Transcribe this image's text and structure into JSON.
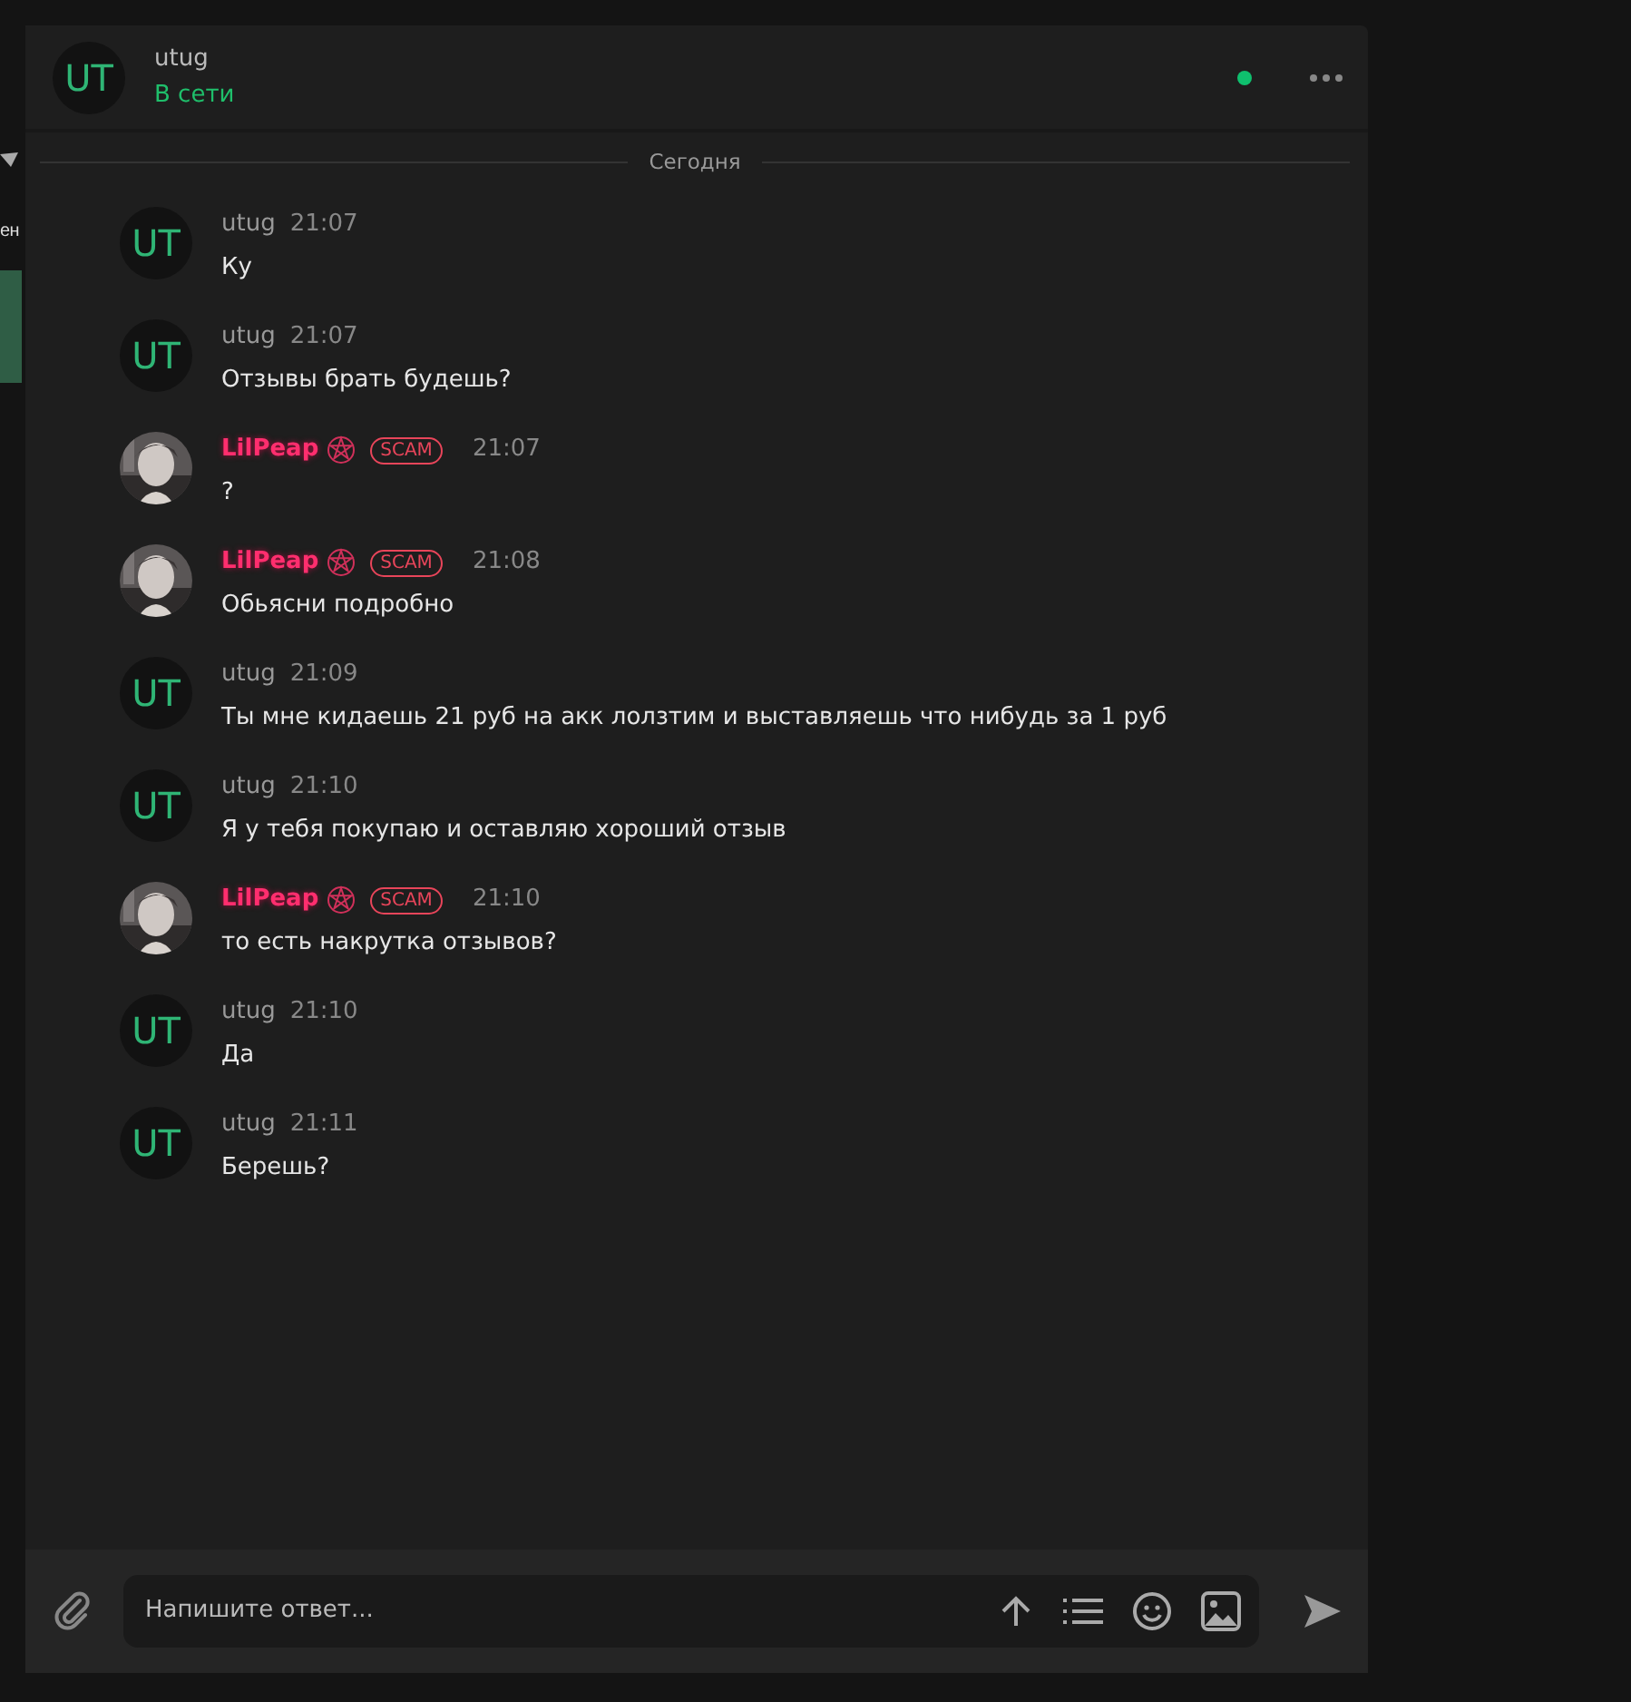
{
  "sidebar": {
    "text_fragment": "ен"
  },
  "chat_header": {
    "avatar_initials": "UT",
    "name": "utug",
    "status": "В сети",
    "online": true
  },
  "date_divider": "Сегодня",
  "messages": [
    {
      "author": "utug",
      "kind": "user",
      "avatar_initials": "UT",
      "time": "21:07",
      "text": "Ку"
    },
    {
      "author": "utug",
      "kind": "user",
      "avatar_initials": "UT",
      "time": "21:07",
      "text": "Отзывы брать будешь?"
    },
    {
      "author": "LilPeap",
      "kind": "scam",
      "badge": "SCAM",
      "time": "21:07",
      "text": "?"
    },
    {
      "author": "LilPeap",
      "kind": "scam",
      "badge": "SCAM",
      "time": "21:08",
      "text": "Обьясни подробно"
    },
    {
      "author": "utug",
      "kind": "user",
      "avatar_initials": "UT",
      "time": "21:09",
      "text": "Ты мне кидаешь 21 руб на акк лолзтим и выставляешь что нибудь за 1 руб"
    },
    {
      "author": "utug",
      "kind": "user",
      "avatar_initials": "UT",
      "time": "21:10",
      "text": "Я у тебя покупаю и оставляю хороший отзыв"
    },
    {
      "author": "LilPeap",
      "kind": "scam",
      "badge": "SCAM",
      "time": "21:10",
      "text": "то есть накрутка отзывов?"
    },
    {
      "author": "utug",
      "kind": "user",
      "avatar_initials": "UT",
      "time": "21:10",
      "text": "Да"
    },
    {
      "author": "utug",
      "kind": "user",
      "avatar_initials": "UT",
      "time": "21:11",
      "text": "Берешь?"
    }
  ],
  "composer": {
    "placeholder": "Напишите ответ..."
  }
}
